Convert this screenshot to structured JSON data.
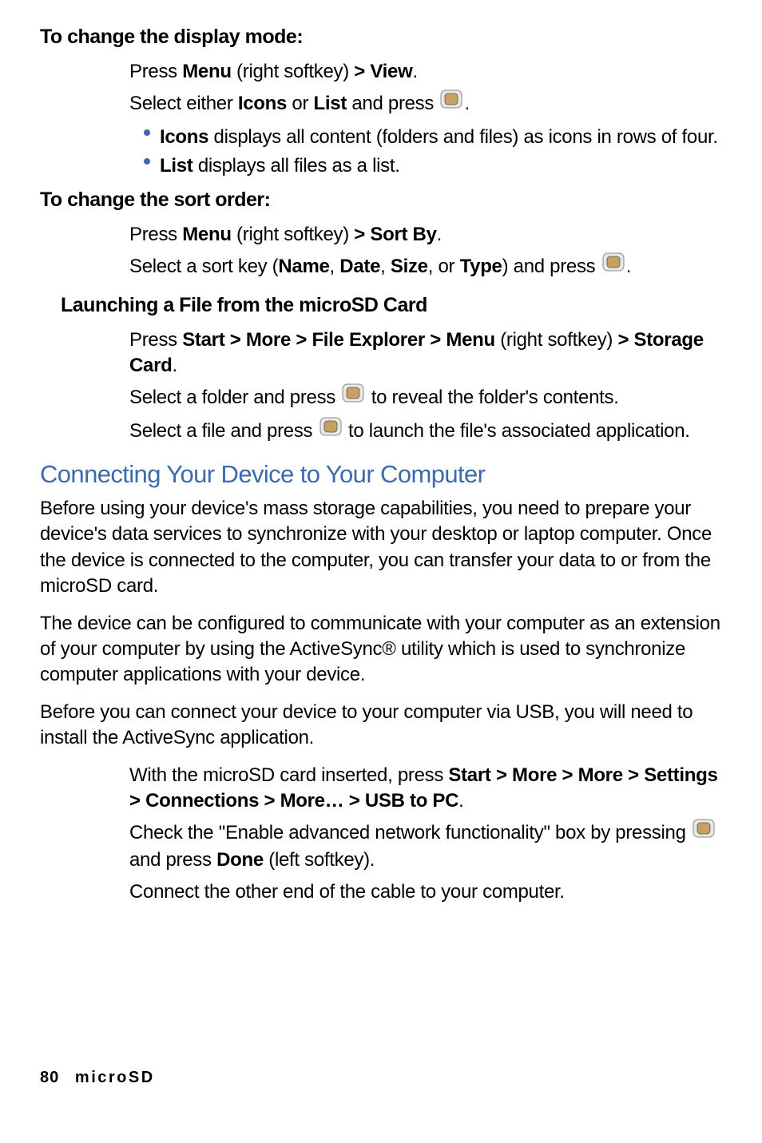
{
  "h1": "To change the display mode:",
  "s1a_pre": "Press ",
  "s1a_b1": "Menu",
  "s1a_mid": " (right softkey) ",
  "s1a_b2": "> View",
  "s1a_post": ".",
  "s1b_pre": "Select either ",
  "s1b_b1": "Icons",
  "s1b_mid": " or ",
  "s1b_b2": "List",
  "s1b_post1": " and press ",
  "s1b_post2": ".",
  "bul1_b": "Icons",
  "bul1_t": " displays all content (folders and files) as icons in rows of four.",
  "bul2_b": "List",
  "bul2_t": " displays all files as a list.",
  "h2": "To change the sort order:",
  "s2a_pre": "Press ",
  "s2a_b1": "Menu",
  "s2a_mid": " (right softkey) ",
  "s2a_b2": "> Sort By",
  "s2a_post": ".",
  "s2b_pre": "Select a sort key (",
  "s2b_b1": "Name",
  "s2b_c1": ", ",
  "s2b_b2": "Date",
  "s2b_c2": ", ",
  "s2b_b3": "Size",
  "s2b_c3": ", or ",
  "s2b_b4": "Type",
  "s2b_post1": ") and press ",
  "s2b_post2": ".",
  "h3": "Launching a File from the microSD Card",
  "s3a_pre": "Press ",
  "s3a_b1": "Start > More > File Explorer > Menu",
  "s3a_mid": " (right softkey) ",
  "s3a_b2": "> Storage Card",
  "s3a_post": ".",
  "s3b_pre": "Select a folder and press ",
  "s3b_post": " to reveal the folder's contents.",
  "s3c_pre": "Select a file and press ",
  "s3c_post": " to launch the file's associated application.",
  "h4": "Connecting Your Device to Your Computer",
  "p1": "Before using your device's mass storage capabilities, you need to prepare your device's data services to synchronize with your desktop or laptop computer. Once the device is connected to the computer, you can transfer your data to or from the microSD card.",
  "p2": "The device can be configured to communicate with your computer as an extension of your computer by using the ActiveSync® utility which is used to synchronize computer applications with your device.",
  "p3": "Before you can connect your device to your computer via USB, you will need to install the ActiveSync application.",
  "s4a_pre": "With the microSD card inserted, press ",
  "s4a_b1": "Start > More > More > Settings > Connections > More… > USB to PC",
  "s4a_post": ".",
  "s4b_pre": "Check the \"Enable advanced network functionality\" box by pressing ",
  "s4b_mid": " and press ",
  "s4b_b1": "Done",
  "s4b_post": " (left softkey).",
  "s4c": "Connect the other end of the cable to your computer.",
  "footer_pg": "80",
  "footer_title": "microSD"
}
